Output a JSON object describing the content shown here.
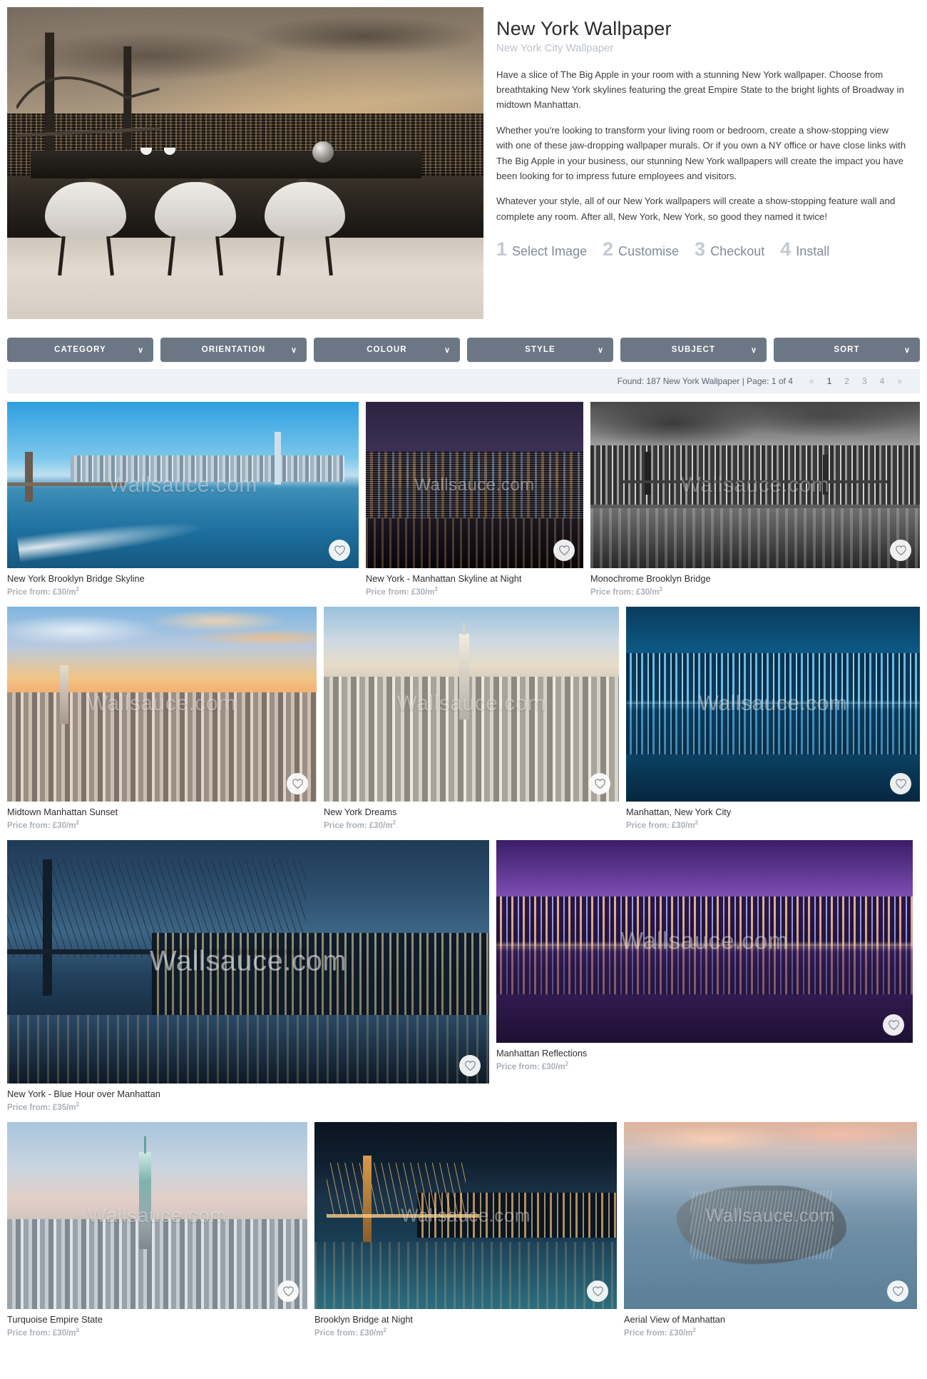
{
  "hero": {
    "title": "New York Wallpaper",
    "subtitle": "New York City Wallpaper",
    "paragraphs": [
      "Have a slice of The Big Apple in your room with a stunning New York wallpaper. Choose from breathtaking New York skylines featuring the great Empire State to the bright lights of Broadway in midtown Manhattan.",
      "Whether you're looking to transform your living room or bedroom, create a show-stopping view with one of these jaw-dropping wallpaper murals. Or if you own a NY office or have close links with The Big Apple in your business, our stunning New York wallpapers will create the impact you have been looking for to impress future employees and visitors.",
      "Whatever your style, all of our New York wallpapers will create a show-stopping feature wall and complete any room. After all, New York, New York, so good they named it twice!"
    ],
    "image_alt": "New York skyline mural in a dining room"
  },
  "steps": [
    {
      "num": "1",
      "label": "Select Image"
    },
    {
      "num": "2",
      "label": "Customise"
    },
    {
      "num": "3",
      "label": "Checkout"
    },
    {
      "num": "4",
      "label": "Install"
    }
  ],
  "filters": [
    {
      "label": "CATEGORY",
      "caret": "∨"
    },
    {
      "label": "ORIENTATION",
      "caret": "∨"
    },
    {
      "label": "COLOUR",
      "caret": "∨"
    },
    {
      "label": "STYLE",
      "caret": "∨"
    },
    {
      "label": "SUBJECT",
      "caret": "∨"
    },
    {
      "label": "SORT",
      "caret": "∨"
    }
  ],
  "results": {
    "summary": "Found: 187 New York Wallpaper | Page: 1 of 4",
    "pages": [
      {
        "label": "«",
        "current": false,
        "arrow": true
      },
      {
        "label": "1",
        "current": true,
        "arrow": false
      },
      {
        "label": "2",
        "current": false,
        "arrow": false
      },
      {
        "label": "3",
        "current": false,
        "arrow": false
      },
      {
        "label": "4",
        "current": false,
        "arrow": false
      },
      {
        "label": "»",
        "current": false,
        "arrow": true
      }
    ]
  },
  "watermark": "Wallsauce.com",
  "price_unit": "m",
  "price_exp": "2",
  "products": [
    {
      "title": "New York Brooklyn Bridge Skyline",
      "price": "Price from: £30/m",
      "exp": "2"
    },
    {
      "title": "New York - Manhattan Skyline at Night",
      "price": "Price from: £30/m",
      "exp": "2"
    },
    {
      "title": "Monochrome Brooklyn Bridge",
      "price": "Price from: £30/m",
      "exp": "2"
    },
    {
      "title": "Midtown Manhattan Sunset",
      "price": "Price from: £30/m",
      "exp": "2"
    },
    {
      "title": "New York Dreams",
      "price": "Price from: £30/m",
      "exp": "2"
    },
    {
      "title": "Manhattan, New York City",
      "price": "Price from: £30/m",
      "exp": "2"
    },
    {
      "title": "New York - Blue Hour over Manhattan",
      "price": "Price from: £35/m",
      "exp": "2"
    },
    {
      "title": "Manhattan Reflections",
      "price": "Price from: £30/m",
      "exp": "2"
    },
    {
      "title": "Turquoise Empire State",
      "price": "Price from: £30/m",
      "exp": "2"
    },
    {
      "title": "Brooklyn Bridge at Night",
      "price": "Price from: £30/m",
      "exp": "2"
    },
    {
      "title": "Aerial View of Manhattan",
      "price": "Price from: £30/m",
      "exp": "2"
    }
  ],
  "icons": {
    "favourite": "heart-icon",
    "dropdown": "chevron-down-icon"
  },
  "colors": {
    "filter_bg": "#6b7784",
    "results_bg": "#eef1f5",
    "price_text": "#a9b0b8",
    "subtitle": "#b9c2cb"
  }
}
